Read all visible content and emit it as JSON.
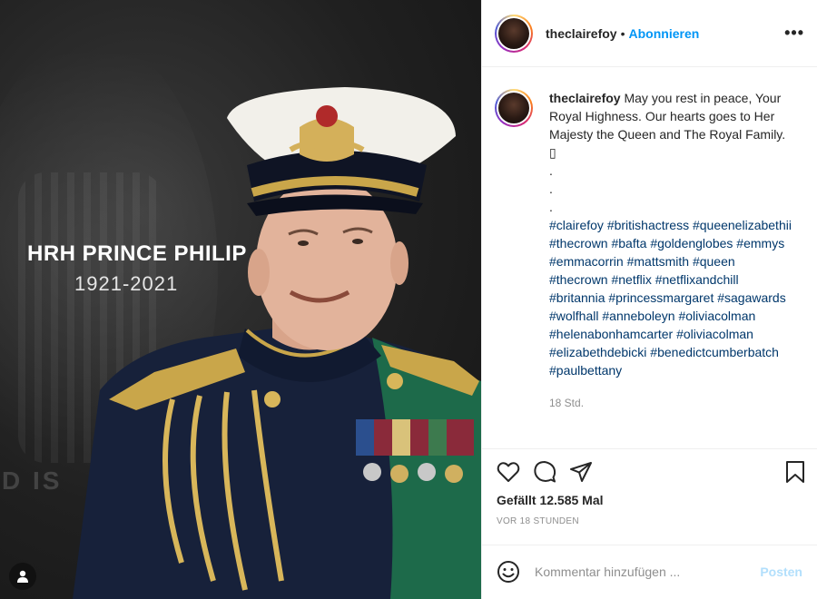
{
  "photo": {
    "memorial_title": "HRH PRINCE PHILIP",
    "memorial_years": "1921-2021",
    "background_motto": "D IS",
    "user_tag_icon": "user-icon"
  },
  "header": {
    "username": "theclairefoy",
    "separator": "•",
    "follow_label": "Abonnieren",
    "more_icon": "more-options-icon",
    "more_label": "•••"
  },
  "caption": {
    "username": "theclairefoy",
    "text": " May you rest in peace, Your Royal Highness. Our hearts goes to Her Majesty the Queen and The Royal Family. ▯",
    "dots": [
      ".",
      ".",
      "."
    ],
    "hashtags": [
      "#clairefoy",
      "#britishactress",
      "#queenelizabethii",
      "#thecrown",
      "#bafta",
      "#goldenglobes",
      "#emmys",
      "#emmacorrin",
      "#mattsmith",
      "#queen",
      "#thecrown",
      "#netflix",
      "#netflixandchill",
      "#britannia",
      "#princessmargaret",
      "#sagawards",
      "#wolfhall",
      "#anneboleyn",
      "#oliviacolman",
      "#helenabonhamcarter",
      "#oliviacolman",
      "#elizabethdebicki",
      "#benedictcumberbatch",
      "#paulbettany"
    ],
    "timestamp": "18 Std."
  },
  "actions": {
    "icons": [
      "heart-icon",
      "comment-icon",
      "share-icon",
      "bookmark-icon"
    ],
    "likes": "Gefällt 12.585 Mal",
    "post_age": "VOR 18 STUNDEN"
  },
  "comment": {
    "emoji_icon": "emoji-icon",
    "placeholder": "Kommentar hinzufügen ...",
    "post_label": "Posten"
  },
  "colors": {
    "link_blue": "#0095f6",
    "hashtag_blue": "#00376b",
    "post_disabled": "#b2dffc",
    "muted": "#8e8e8e"
  }
}
